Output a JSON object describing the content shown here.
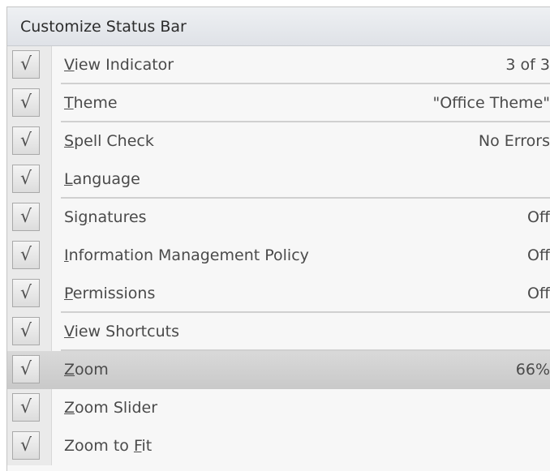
{
  "menu": {
    "title": "Customize Status Bar",
    "items": [
      {
        "label_pre": "",
        "label_u": "V",
        "label_post": "iew Indicator",
        "value": "3 of 3",
        "checked": true
      },
      {
        "label_pre": "",
        "label_u": "T",
        "label_post": "heme",
        "value": "\"Office Theme\"",
        "checked": true
      },
      {
        "label_pre": "",
        "label_u": "S",
        "label_post": "pell Check",
        "value": "No Errors",
        "checked": true
      },
      {
        "label_pre": "",
        "label_u": "L",
        "label_post": "anguage",
        "value": "",
        "checked": true
      },
      {
        "label_pre": "Si",
        "label_u": "g",
        "label_post": "natures",
        "value": "Off",
        "checked": true
      },
      {
        "label_pre": "",
        "label_u": "I",
        "label_post": "nformation Management Policy",
        "value": "Off",
        "checked": true
      },
      {
        "label_pre": "",
        "label_u": "P",
        "label_post": "ermissions",
        "value": "Off",
        "checked": true
      },
      {
        "label_pre": "",
        "label_u": "V",
        "label_post": "iew Shortcuts",
        "value": "",
        "checked": true
      },
      {
        "label_pre": "",
        "label_u": "Z",
        "label_post": "oom",
        "value": "66%",
        "checked": true
      },
      {
        "label_pre": "",
        "label_u": "Z",
        "label_post": "oom Slider",
        "value": "",
        "checked": true
      },
      {
        "label_pre": "Zoom to ",
        "label_u": "F",
        "label_post": "it",
        "value": "",
        "checked": true
      }
    ],
    "check_glyph": "√"
  }
}
